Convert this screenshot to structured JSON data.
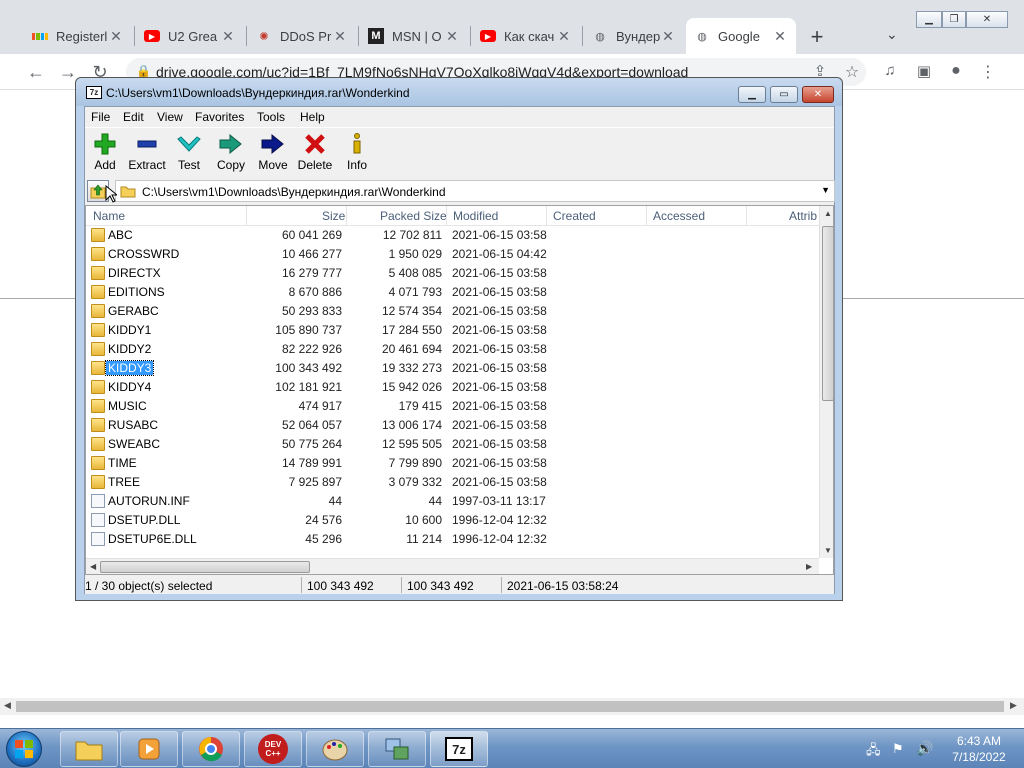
{
  "browser": {
    "tabs": [
      {
        "title": "Registerl",
        "icon": "microsoft-icon"
      },
      {
        "title": "U2 Grea",
        "icon": "youtube-icon"
      },
      {
        "title": "DDoS Pr",
        "icon": "ddos-icon"
      },
      {
        "title": "MSN | O",
        "icon": "msn-icon"
      },
      {
        "title": "Как скач",
        "icon": "youtube-icon"
      },
      {
        "title": "Вундерк",
        "icon": "globe-icon"
      },
      {
        "title": "Google",
        "icon": "globe-icon",
        "active": true
      }
    ],
    "url": "drive.google.com/uc?id=1Bf_7LM9fNo6sNHgV7OoXqlko8iWqgV4d&export=download",
    "new_tab": "+",
    "tab_menu": "⌄"
  },
  "zip": {
    "title": "C:\\Users\\vm1\\Downloads\\Вундеркиндия.rar\\Wonderkind",
    "app_icon": "7z",
    "menu": [
      "File",
      "Edit",
      "View",
      "Favorites",
      "Tools",
      "Help"
    ],
    "toolbar": [
      {
        "label": "Add",
        "icon": "add-icon",
        "color": "#22a822"
      },
      {
        "label": "Extract",
        "icon": "extract-icon",
        "color": "#1f3faa"
      },
      {
        "label": "Test",
        "icon": "test-icon",
        "color": "#19b7b7"
      },
      {
        "label": "Copy",
        "icon": "copy-icon",
        "color": "#1a8a6a"
      },
      {
        "label": "Move",
        "icon": "move-icon",
        "color": "#0a1a8a"
      },
      {
        "label": "Delete",
        "icon": "delete-icon",
        "color": "#d01010"
      },
      {
        "label": "Info",
        "icon": "info-icon",
        "color": "#d8b000"
      }
    ],
    "address": "C:\\Users\\vm1\\Downloads\\Вундеркиндия.rar\\Wonderkind",
    "columns": [
      "Name",
      "Size",
      "Packed Size",
      "Modified",
      "Created",
      "Accessed",
      "Attrib"
    ],
    "rows": [
      {
        "name": "ABC",
        "type": "folder",
        "size": "60 041 269",
        "packed": "12 702 811",
        "modified": "2021-06-15 03:58"
      },
      {
        "name": "CROSSWRD",
        "type": "folder",
        "size": "10 466 277",
        "packed": "1 950 029",
        "modified": "2021-06-15 04:42"
      },
      {
        "name": "DIRECTX",
        "type": "folder",
        "size": "16 279 777",
        "packed": "5 408 085",
        "modified": "2021-06-15 03:58"
      },
      {
        "name": "EDITIONS",
        "type": "folder",
        "size": "8 670 886",
        "packed": "4 071 793",
        "modified": "2021-06-15 03:58"
      },
      {
        "name": "GERABC",
        "type": "folder",
        "size": "50 293 833",
        "packed": "12 574 354",
        "modified": "2021-06-15 03:58"
      },
      {
        "name": "KIDDY1",
        "type": "folder",
        "size": "105 890 737",
        "packed": "17 284 550",
        "modified": "2021-06-15 03:58"
      },
      {
        "name": "KIDDY2",
        "type": "folder",
        "size": "82 222 926",
        "packed": "20 461 694",
        "modified": "2021-06-15 03:58"
      },
      {
        "name": "KIDDY3",
        "type": "folder",
        "size": "100 343 492",
        "packed": "19 332 273",
        "modified": "2021-06-15 03:58",
        "selected": true
      },
      {
        "name": "KIDDY4",
        "type": "folder",
        "size": "102 181 921",
        "packed": "15 942 026",
        "modified": "2021-06-15 03:58"
      },
      {
        "name": "MUSIC",
        "type": "folder",
        "size": "474 917",
        "packed": "179 415",
        "modified": "2021-06-15 03:58"
      },
      {
        "name": "RUSABC",
        "type": "folder",
        "size": "52 064 057",
        "packed": "13 006 174",
        "modified": "2021-06-15 03:58"
      },
      {
        "name": "SWEABC",
        "type": "folder",
        "size": "50 775 264",
        "packed": "12 595 505",
        "modified": "2021-06-15 03:58"
      },
      {
        "name": "TIME",
        "type": "folder",
        "size": "14 789 991",
        "packed": "7 799 890",
        "modified": "2021-06-15 03:58"
      },
      {
        "name": "TREE",
        "type": "folder",
        "size": "7 925 897",
        "packed": "3 079 332",
        "modified": "2021-06-15 03:58"
      },
      {
        "name": "AUTORUN.INF",
        "type": "file",
        "size": "44",
        "packed": "44",
        "modified": "1997-03-11 13:17"
      },
      {
        "name": "DSETUP.DLL",
        "type": "file",
        "size": "24 576",
        "packed": "10 600",
        "modified": "1996-12-04 12:32"
      },
      {
        "name": "DSETUP6E.DLL",
        "type": "file",
        "size": "45 296",
        "packed": "11 214",
        "modified": "1996-12-04 12:32"
      }
    ],
    "status": {
      "selection": "1 / 30 object(s) selected",
      "size": "100 343 492",
      "packed": "100 343 492",
      "modified": "2021-06-15 03:58:24"
    }
  },
  "taskbar": {
    "apps": [
      {
        "name": "explorer",
        "icon": "folder-icon"
      },
      {
        "name": "media-player",
        "icon": "media-player-icon"
      },
      {
        "name": "chrome",
        "icon": "chrome-icon"
      },
      {
        "name": "devcpp",
        "icon": "devcpp-icon",
        "label": "DEV C++"
      },
      {
        "name": "paint",
        "icon": "paint-icon"
      },
      {
        "name": "network",
        "icon": "network-icon"
      },
      {
        "name": "7zip",
        "icon": "7zip-icon",
        "label": "7z",
        "active": true
      }
    ],
    "time": "6:43 AM",
    "date": "7/18/2022"
  }
}
